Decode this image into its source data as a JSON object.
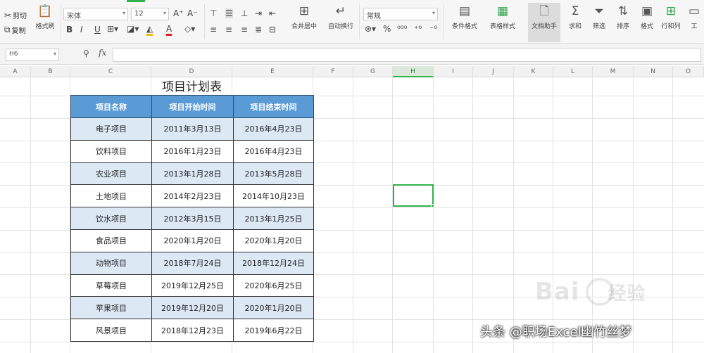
{
  "ribbon": {
    "cut": "剪切",
    "paste_label": "粘贴",
    "copy": "复制",
    "format_painter": "格式刷",
    "font_name": "宋体",
    "font_size": "12",
    "bold": "B",
    "italic": "I",
    "underline": "U",
    "font_color_glyph": "A",
    "grow_font": "A⁺",
    "shrink_font": "A⁻",
    "merge_center": "合并居中",
    "wrap_text": "自动换行",
    "number_format": "常规",
    "percent": "%",
    "conditional_format": "条件格式",
    "table_style": "表格样式",
    "sheet_tools": "文档助手",
    "sum": "求和",
    "filter": "筛选",
    "sort": "排序",
    "format": "格式",
    "fill": "填充",
    "row_col": "行和列",
    "worksheet": "工"
  },
  "formula_bar": {
    "name_box": "H6",
    "fx": "fx",
    "zoom_icon": "zoom-icon"
  },
  "columns": [
    "A",
    "B",
    "C",
    "D",
    "E",
    "F",
    "G",
    "H",
    "I",
    "J",
    "K",
    "L",
    "M",
    "N",
    "O"
  ],
  "selected_column": "H",
  "table": {
    "title": "项目计划表",
    "headers": [
      "项目名称",
      "项目开始时间",
      "项目结束时间"
    ],
    "rows": [
      [
        "电子项目",
        "2011年3月13日",
        "2016年4月23日"
      ],
      [
        "饮料项目",
        "2016年1月23日",
        "2016年4月23日"
      ],
      [
        "农业项目",
        "2013年1月28日",
        "2013年5月28日"
      ],
      [
        "土地项目",
        "2014年2月23日",
        "2014年10月23日"
      ],
      [
        "饮水项目",
        "2012年3月15日",
        "2013年1月25日"
      ],
      [
        "食品项目",
        "2020年1月20日",
        "2020年1月20日"
      ],
      [
        "动物项目",
        "2018年7月24日",
        "2018年12月24日"
      ],
      [
        "草莓项目",
        "2019年12月25日",
        "2020年6月25日"
      ],
      [
        "苹果项目",
        "2019年12月20日",
        "2020年1月20日"
      ],
      [
        "风景项目",
        "2018年12月23日",
        "2019年6月22日"
      ]
    ]
  },
  "watermarks": {
    "baidu": "Bai",
    "baidu_cn": "经验",
    "toutiao": "头条 @职场Excel幽竹丝梦"
  },
  "colors": {
    "header_fill": "#5b9bd5",
    "alt_row_fill": "#dce8f4",
    "selection": "#2fb34a"
  }
}
